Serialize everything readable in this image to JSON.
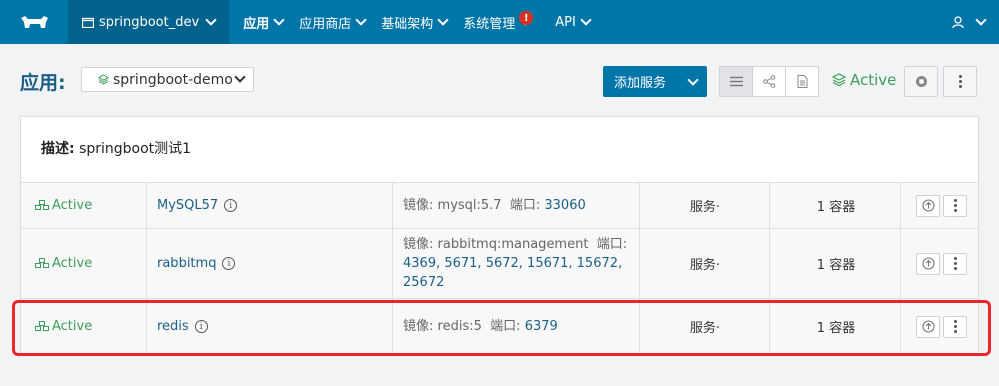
{
  "nav": {
    "env": "springboot_dev",
    "items": [
      "应用",
      "应用商店",
      "基础架构",
      "系统管理",
      "API"
    ],
    "alert_badge": "!"
  },
  "header": {
    "title": "应用:",
    "stack": "springboot-demo",
    "add_service": "添加服务",
    "status": "Active"
  },
  "panel": {
    "desc_label": "描述:",
    "desc_value": "springboot测试1"
  },
  "services": [
    {
      "state": "Active",
      "name": "MySQL57",
      "image_label": "镜像:",
      "image": "mysql:5.7",
      "port_label": "端口:",
      "ports": "33060",
      "kind": "服务·",
      "containers": "1 容器"
    },
    {
      "state": "Active",
      "name": "rabbitmq",
      "image_label": "镜像:",
      "image": "rabbitmq:management",
      "port_label": "端口:",
      "ports": "4369, 5671, 5672, 15671, 15672, 25672",
      "kind": "服务·",
      "containers": "1 容器"
    },
    {
      "state": "Active",
      "name": "redis",
      "image_label": "镜像:",
      "image": "redis:5",
      "port_label": "端口:",
      "ports": "6379",
      "kind": "服务·",
      "containers": "1 容器"
    }
  ],
  "colors": {
    "nav": "#0075a8",
    "active": "#3e9e5b",
    "link": "#1a5f86",
    "highlight": "#e8262a"
  }
}
